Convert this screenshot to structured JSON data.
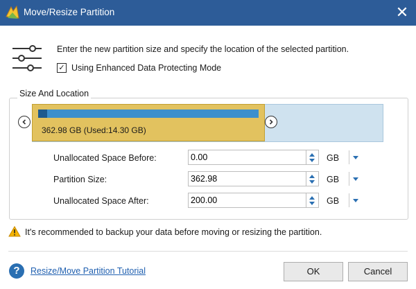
{
  "window": {
    "title": "Move/Resize Partition",
    "close_icon": "close-icon"
  },
  "header": {
    "instruction": "Enter the new partition size and specify the location of the selected partition.",
    "checkbox_label": "Using Enhanced Data Protecting Mode",
    "checkbox_checked": true,
    "checkmark": "✓"
  },
  "group": {
    "title": "Size And Location",
    "partition_label": "362.98 GB (Used:14.30 GB)",
    "used_fraction": 0.04,
    "partition_fraction": 0.645
  },
  "fields": [
    {
      "label": "Unallocated Space Before:",
      "value": "0.00",
      "unit": "GB"
    },
    {
      "label": "Partition Size:",
      "value": "362.98",
      "unit": "GB"
    },
    {
      "label": "Unallocated Space After:",
      "value": "200.00",
      "unit": "GB"
    }
  ],
  "warning": "It's recommended to backup your data before moving or resizing the partition.",
  "footer": {
    "help_symbol": "?",
    "help_link": "Resize/Move Partition Tutorial",
    "ok_label": "OK",
    "cancel_label": "Cancel"
  },
  "colors": {
    "titlebar": "#2d5c98",
    "partition": "#e2c25f",
    "unallocated": "#cfe2ef",
    "bar": "#3c8fcc",
    "used": "#1d5a8e",
    "link": "#2060b0"
  }
}
